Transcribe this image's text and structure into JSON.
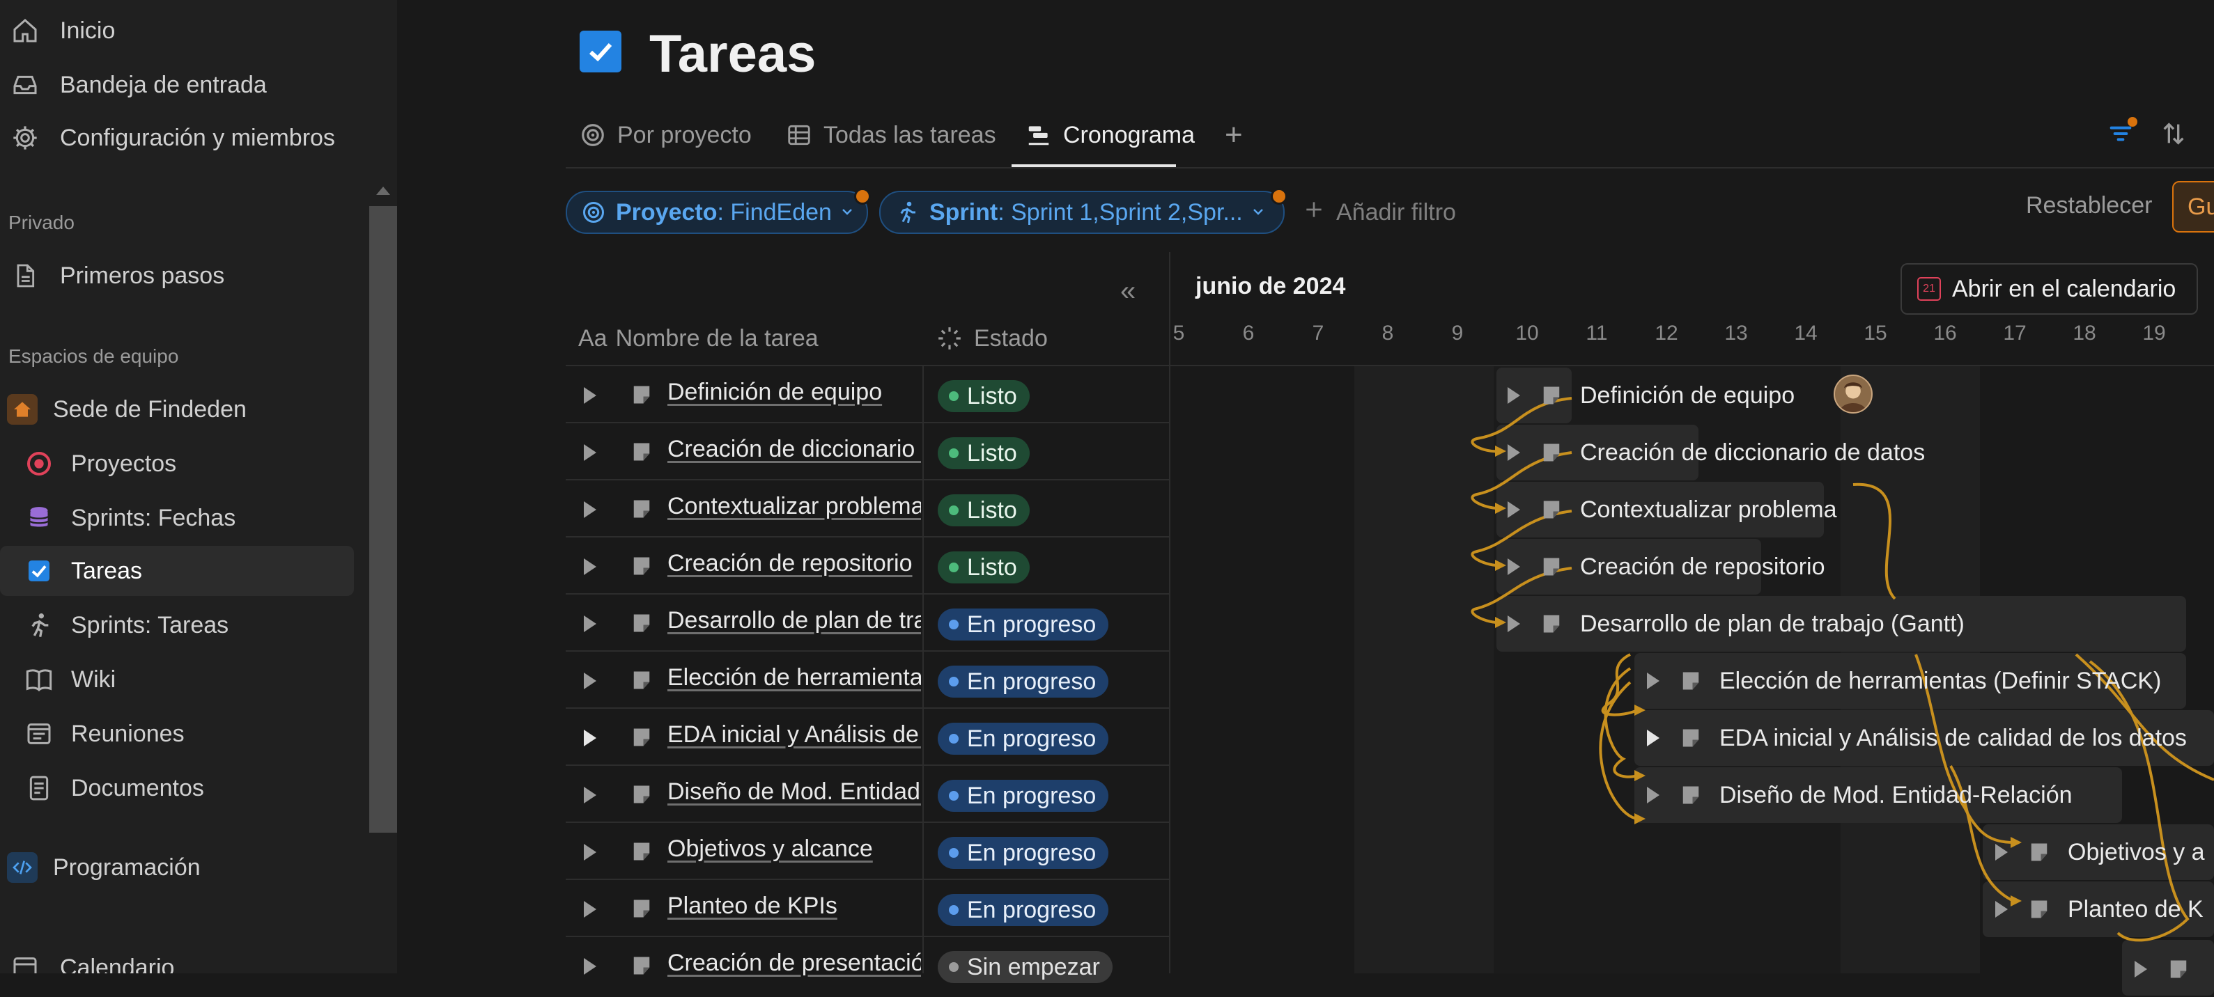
{
  "sidebar": {
    "top_items": [
      {
        "label": "Inicio",
        "icon": "home-icon"
      },
      {
        "label": "Bandeja de entrada",
        "icon": "inbox-icon"
      },
      {
        "label": "Configuración y miembros",
        "icon": "gear-icon"
      }
    ],
    "private_label": "Privado",
    "private_items": [
      {
        "label": "Primeros pasos",
        "icon": "page-icon"
      }
    ],
    "teams_label": "Espacios de equipo",
    "workspace": {
      "label": "Sede de Findeden",
      "icon": "house-icon",
      "color": "#d9730d"
    },
    "workspace_items": [
      {
        "label": "Proyectos",
        "icon": "target-icon"
      },
      {
        "label": "Sprints: Fechas",
        "icon": "database-icon"
      },
      {
        "label": "Tareas",
        "icon": "checkbox-icon",
        "active": true
      },
      {
        "label": "Sprints: Tareas",
        "icon": "runner-icon"
      },
      {
        "label": "Wiki",
        "icon": "book-icon"
      },
      {
        "label": "Reuniones",
        "icon": "notes-icon"
      },
      {
        "label": "Documentos",
        "icon": "document-icon"
      }
    ],
    "programming": {
      "label": "Programación",
      "icon": "code-icon"
    },
    "calendar": {
      "label": "Calendario",
      "icon": "calendar-icon"
    }
  },
  "page": {
    "title": "Tareas",
    "tabs": [
      {
        "label": "Por proyecto",
        "icon": "target-icon"
      },
      {
        "label": "Todas las tareas",
        "icon": "table-icon"
      },
      {
        "label": "Cronograma",
        "icon": "timeline-icon",
        "active": true
      }
    ],
    "add_view": "+"
  },
  "filters": {
    "project": {
      "key": "Proyecto",
      "value": ": FindEden"
    },
    "sprint": {
      "key": "Sprint",
      "value": ": Sprint 1,Sprint 2,Spr..."
    },
    "add_filter": "Añadir filtro",
    "reset": "Restablecer",
    "save": "Gu"
  },
  "table": {
    "name_header_prefix": "Aa",
    "name_header": "Nombre de la tarea",
    "status_header": "Estado",
    "rows": [
      {
        "name": "Definición de equipo",
        "status": "Listo"
      },
      {
        "name": "Creación de diccionario de datos",
        "status": "Listo"
      },
      {
        "name": "Contextualizar problema",
        "status": "Listo"
      },
      {
        "name": "Creación de repositorio",
        "status": "Listo"
      },
      {
        "name": "Desarrollo de plan de trabajo (Gantt)",
        "status": "En progreso"
      },
      {
        "name": "Elección de herramientas (Definir STACK)",
        "status": "En progreso"
      },
      {
        "name": "EDA inicial y Análisis de calidad de los datos",
        "status": "En progreso"
      },
      {
        "name": "Diseño de Mod. Entidad-Relación",
        "status": "En progreso"
      },
      {
        "name": "Objetivos y alcance",
        "status": "En progreso"
      },
      {
        "name": "Planteo de KPIs",
        "status": "En progreso"
      },
      {
        "name": "Creación de presentación",
        "status": "Sin empezar"
      }
    ]
  },
  "timeline": {
    "month": "junio de 2024",
    "open_calendar": "Abrir en el calendario",
    "calendar_day": "21",
    "days": [
      "5",
      "6",
      "7",
      "8",
      "9",
      "10",
      "11",
      "12",
      "13",
      "14",
      "15",
      "16",
      "17",
      "18",
      "19"
    ],
    "bars": [
      {
        "label": "Definición de equipo"
      },
      {
        "label": "Creación de diccionario de datos"
      },
      {
        "label": "Contextualizar problema"
      },
      {
        "label": "Creación de repositorio"
      },
      {
        "label": "Desarrollo de plan de trabajo (Gantt)"
      },
      {
        "label": "Elección de herramientas (Definir STACK)"
      },
      {
        "label": "EDA inicial y Análisis de calidad de los datos"
      },
      {
        "label": "Diseño de Mod. Entidad-Relación"
      },
      {
        "label": "Objetivos y a"
      },
      {
        "label": "Planteo de K"
      }
    ],
    "dependency_color": "#c8901e"
  },
  "colors": {
    "accent": "#2383e2",
    "status_done": "#4dbb7c",
    "status_progress": "#5c9ded",
    "status_not_started": "#9b9b9b"
  }
}
